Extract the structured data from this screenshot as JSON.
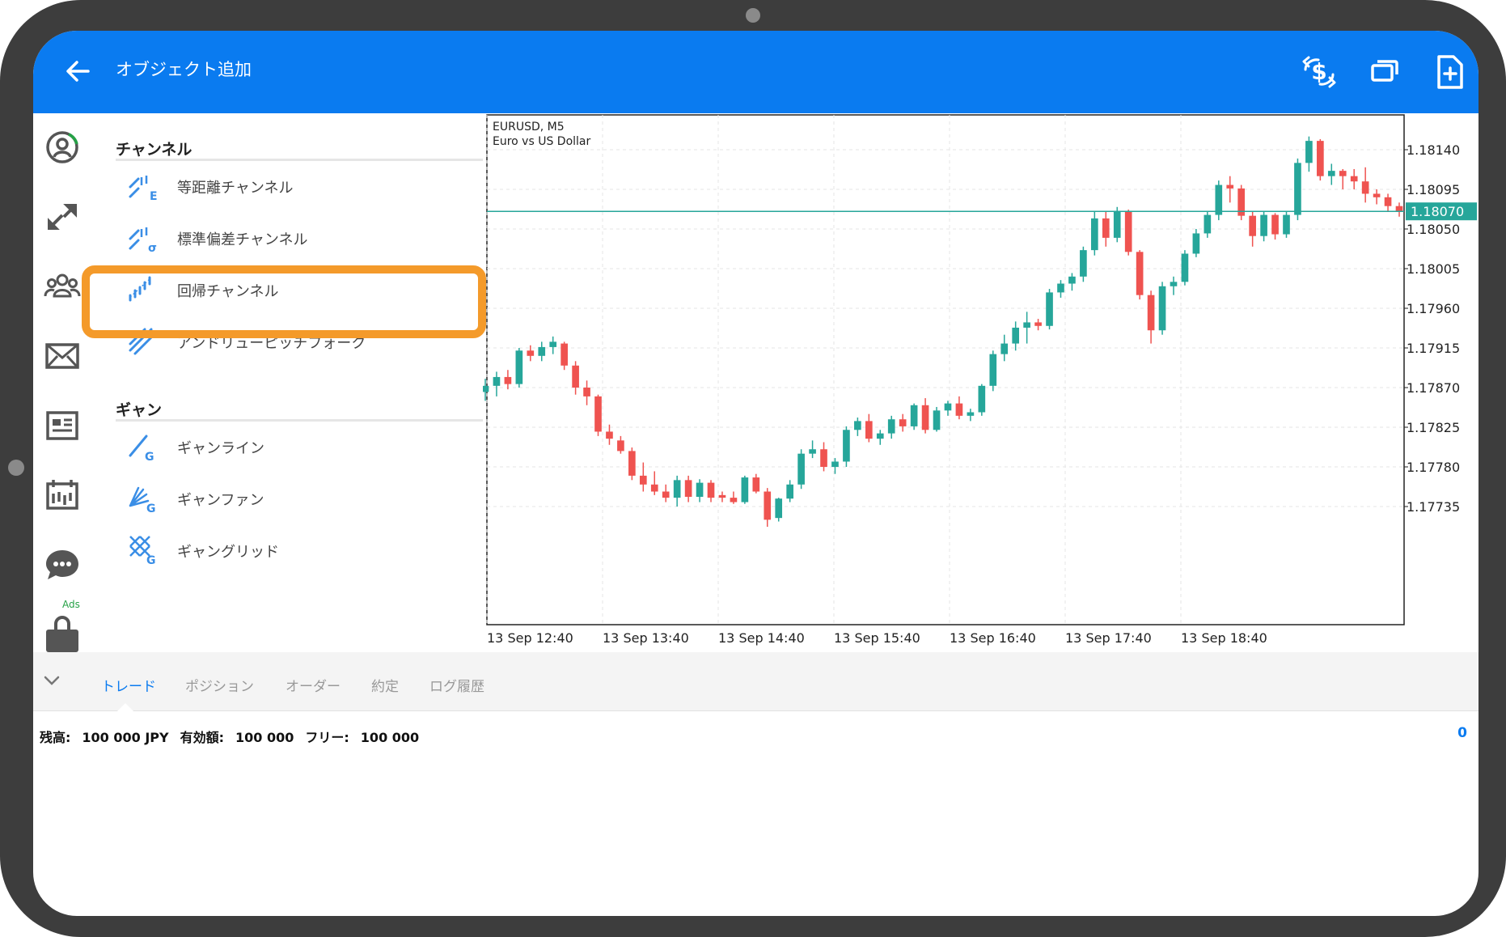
{
  "app": {
    "title": "オブジェクト追加"
  },
  "panel": {
    "sections": [
      {
        "title": "チャンネル",
        "items": [
          {
            "label": "等距離チャンネル",
            "icon": "equidistant-channel-icon"
          },
          {
            "label": "標準偏差チャンネル",
            "icon": "stddev-channel-icon"
          },
          {
            "label": "回帰チャンネル",
            "icon": "regression-channel-icon",
            "highlighted": true
          },
          {
            "label": "アンドリューピッチフォーク",
            "icon": "pitchfork-icon"
          }
        ]
      },
      {
        "title": "ギャン",
        "items": [
          {
            "label": "ギャンライン",
            "icon": "gann-line-icon"
          },
          {
            "label": "ギャンファン",
            "icon": "gann-fan-icon"
          },
          {
            "label": "ギャングリッド",
            "icon": "gann-grid-icon"
          }
        ]
      }
    ]
  },
  "leftbar": {
    "ads_label": "Ads"
  },
  "tabs": [
    {
      "label": "トレード",
      "active": true
    },
    {
      "label": "ポジション",
      "active": false
    },
    {
      "label": "オーダー",
      "active": false
    },
    {
      "label": "約定",
      "active": false
    },
    {
      "label": "ログ履歴",
      "active": false
    }
  ],
  "account": {
    "balance_label": "残高:",
    "balance_value": "100 000 JPY",
    "equity_label": "有効額:",
    "equity_value": "100 000",
    "free_label": "フリー:",
    "free_value": "100 000",
    "right_value": "0"
  },
  "colors": {
    "accent": "#0a7bf0",
    "bull": "#26a69a",
    "bear": "#ef5350",
    "highlight": "#f49a2a"
  },
  "chart_data": {
    "type": "candlestick",
    "symbol_label": "EURUSD, M5",
    "description_label": "Euro vs US Dollar",
    "current_price": "1.18070",
    "ylim": [
      1.1769,
      1.1816
    ],
    "y_ticks": [
      "1.18140",
      "1.18095",
      "1.18050",
      "1.18005",
      "1.17960",
      "1.17915",
      "1.17870",
      "1.17825",
      "1.17780",
      "1.17735"
    ],
    "x_ticks": [
      "13 Sep 12:40",
      "13 Sep 13:40",
      "13 Sep 14:40",
      "13 Sep 15:40",
      "13 Sep 16:40",
      "13 Sep 17:40",
      "13 Sep 18:40"
    ],
    "grid": true,
    "candles": [
      [
        1.17865,
        1.1788,
        1.17855,
        1.17872
      ],
      [
        1.17872,
        1.17888,
        1.1786,
        1.17882
      ],
      [
        1.17882,
        1.1789,
        1.17868,
        1.17874
      ],
      [
        1.17874,
        1.17915,
        1.1787,
        1.17912
      ],
      [
        1.17912,
        1.17918,
        1.179,
        1.17906
      ],
      [
        1.17906,
        1.17922,
        1.179,
        1.17916
      ],
      [
        1.17916,
        1.17928,
        1.17908,
        1.17922
      ],
      [
        1.1792,
        1.17922,
        1.1789,
        1.17895
      ],
      [
        1.17895,
        1.179,
        1.17862,
        1.1787
      ],
      [
        1.1787,
        1.17878,
        1.1785,
        1.1786
      ],
      [
        1.1786,
        1.17862,
        1.17815,
        1.1782
      ],
      [
        1.1782,
        1.17828,
        1.17805,
        1.17812
      ],
      [
        1.1781,
        1.17815,
        1.17795,
        1.17798
      ],
      [
        1.17798,
        1.17802,
        1.17765,
        1.1777
      ],
      [
        1.1777,
        1.17785,
        1.17752,
        1.1776
      ],
      [
        1.1776,
        1.17775,
        1.17748,
        1.17752
      ],
      [
        1.17752,
        1.1776,
        1.1774,
        1.17745
      ],
      [
        1.17745,
        1.1777,
        1.17735,
        1.17765
      ],
      [
        1.17765,
        1.1777,
        1.1774,
        1.17746
      ],
      [
        1.17746,
        1.17766,
        1.1774,
        1.17762
      ],
      [
        1.17762,
        1.17765,
        1.1774,
        1.17745
      ],
      [
        1.17748,
        1.17752,
        1.1774,
        1.17745
      ],
      [
        1.17745,
        1.17752,
        1.17738,
        1.1774
      ],
      [
        1.1774,
        1.1777,
        1.17738,
        1.17768
      ],
      [
        1.17768,
        1.17772,
        1.1775,
        1.17752
      ],
      [
        1.17752,
        1.17756,
        1.17712,
        1.1772
      ],
      [
        1.17722,
        1.17745,
        1.17718,
        1.17744
      ],
      [
        1.17744,
        1.17765,
        1.1774,
        1.1776
      ],
      [
        1.1776,
        1.178,
        1.17755,
        1.17795
      ],
      [
        1.17795,
        1.1781,
        1.1779,
        1.178
      ],
      [
        1.178,
        1.17808,
        1.17775,
        1.1778
      ],
      [
        1.1778,
        1.1779,
        1.17772,
        1.17786
      ],
      [
        1.17786,
        1.17826,
        1.1778,
        1.17822
      ],
      [
        1.17822,
        1.17836,
        1.17815,
        1.17832
      ],
      [
        1.17832,
        1.1784,
        1.17808,
        1.17812
      ],
      [
        1.17812,
        1.17822,
        1.17805,
        1.17818
      ],
      [
        1.17818,
        1.17838,
        1.17812,
        1.17834
      ],
      [
        1.17834,
        1.1784,
        1.1782,
        1.17826
      ],
      [
        1.17826,
        1.17852,
        1.17822,
        1.1785
      ],
      [
        1.1785,
        1.17858,
        1.17818,
        1.17822
      ],
      [
        1.17822,
        1.17848,
        1.1782,
        1.17844
      ],
      [
        1.17844,
        1.17855,
        1.17838,
        1.17852
      ],
      [
        1.17852,
        1.1786,
        1.17834,
        1.17838
      ],
      [
        1.17838,
        1.17846,
        1.17832,
        1.17842
      ],
      [
        1.17842,
        1.17874,
        1.17838,
        1.17872
      ],
      [
        1.17872,
        1.17912,
        1.17866,
        1.17908
      ],
      [
        1.17908,
        1.1793,
        1.179,
        1.1792
      ],
      [
        1.1792,
        1.17945,
        1.17912,
        1.17938
      ],
      [
        1.17938,
        1.17956,
        1.1792,
        1.17944
      ],
      [
        1.17944,
        1.17948,
        1.17935,
        1.1794
      ],
      [
        1.1794,
        1.17982,
        1.17936,
        1.17978
      ],
      [
        1.17978,
        1.17992,
        1.17972,
        1.17988
      ],
      [
        1.17988,
        1.18,
        1.1798,
        1.17996
      ],
      [
        1.17996,
        1.1803,
        1.1799,
        1.18026
      ],
      [
        1.18026,
        1.1807,
        1.1802,
        1.18062
      ],
      [
        1.18062,
        1.1807,
        1.1803,
        1.1804
      ],
      [
        1.1804,
        1.18075,
        1.18035,
        1.1807
      ],
      [
        1.1807,
        1.18072,
        1.1802,
        1.18024
      ],
      [
        1.18024,
        1.18026,
        1.1797,
        1.17975
      ],
      [
        1.17975,
        1.1798,
        1.1792,
        1.17935
      ],
      [
        1.17935,
        1.1799,
        1.1793,
        1.17985
      ],
      [
        1.17985,
        1.17996,
        1.17975,
        1.1799
      ],
      [
        1.1799,
        1.18026,
        1.17986,
        1.18022
      ],
      [
        1.18022,
        1.1805,
        1.18018,
        1.18045
      ],
      [
        1.18045,
        1.1807,
        1.1804,
        1.18066
      ],
      [
        1.18066,
        1.18105,
        1.1806,
        1.181
      ],
      [
        1.181,
        1.1811,
        1.1808,
        1.18096
      ],
      [
        1.18096,
        1.181,
        1.1806,
        1.18065
      ],
      [
        1.18065,
        1.1807,
        1.1803,
        1.18042
      ],
      [
        1.18042,
        1.1807,
        1.18036,
        1.18066
      ],
      [
        1.18066,
        1.18068,
        1.18038,
        1.18044
      ],
      [
        1.18044,
        1.1807,
        1.1804,
        1.18066
      ],
      [
        1.18066,
        1.1813,
        1.1806,
        1.18125
      ],
      [
        1.18125,
        1.18155,
        1.18115,
        1.1815
      ],
      [
        1.1815,
        1.18152,
        1.18105,
        1.1811
      ],
      [
        1.1811,
        1.18124,
        1.181,
        1.18116
      ],
      [
        1.18116,
        1.18118,
        1.18095,
        1.1811
      ],
      [
        1.1811,
        1.18118,
        1.18095,
        1.18104
      ],
      [
        1.18104,
        1.1812,
        1.1808,
        1.1809
      ],
      [
        1.1809,
        1.18095,
        1.18078,
        1.18086
      ],
      [
        1.18086,
        1.1809,
        1.1807,
        1.18076
      ],
      [
        1.18076,
        1.1808,
        1.18064,
        1.1807
      ]
    ]
  }
}
